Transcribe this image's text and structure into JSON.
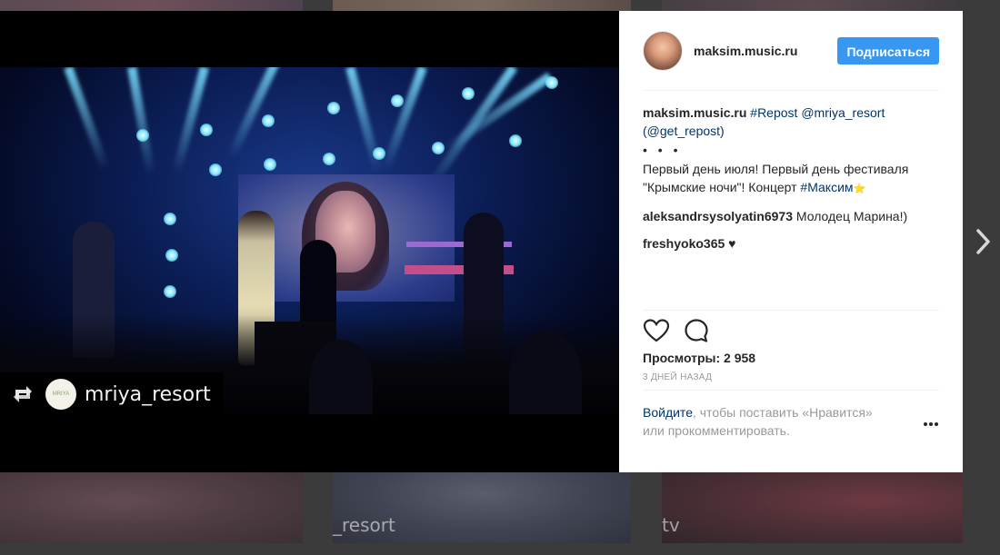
{
  "post": {
    "username": "maksim.music.ru",
    "follow_label": "Подписаться",
    "caption_user": "maksim.music.ru",
    "caption_tag": "#Repost",
    "caption_mention": "@mriya_resort",
    "caption_get_repost": "(@get_repost)",
    "caption_dots": "• • •",
    "caption_text": "Первый день июля! Первый день фестиваля \"Крымские ночи\"! Концерт ",
    "caption_hashtag": "#Максим",
    "caption_star": "⭐",
    "comments": [
      {
        "user": "aleksandrsysolyatin6973",
        "text": "Молодец Марина!)"
      },
      {
        "user": "freshyoko365",
        "text": "♥"
      }
    ],
    "views_label": "Просмотры: 2 958",
    "time_label": "3 ДНЕЙ НАЗАД",
    "login_link": "Войдите",
    "login_text_1": ", чтобы поставить «Нравится»",
    "login_text_2": "или прокомментировать."
  },
  "media": {
    "repost_account": "mriya_resort",
    "logo_text": "MRIYA"
  },
  "background": {
    "ghost_text_1": "_resort",
    "ghost_text_2": "tv"
  },
  "icons": {
    "like": "heart-icon",
    "comment": "comment-icon",
    "more": "more-icon",
    "next": "chevron-right-icon",
    "repost": "repost-icon"
  },
  "colors": {
    "follow_button": "#3897f0",
    "link": "#003569",
    "muted": "#999999"
  }
}
